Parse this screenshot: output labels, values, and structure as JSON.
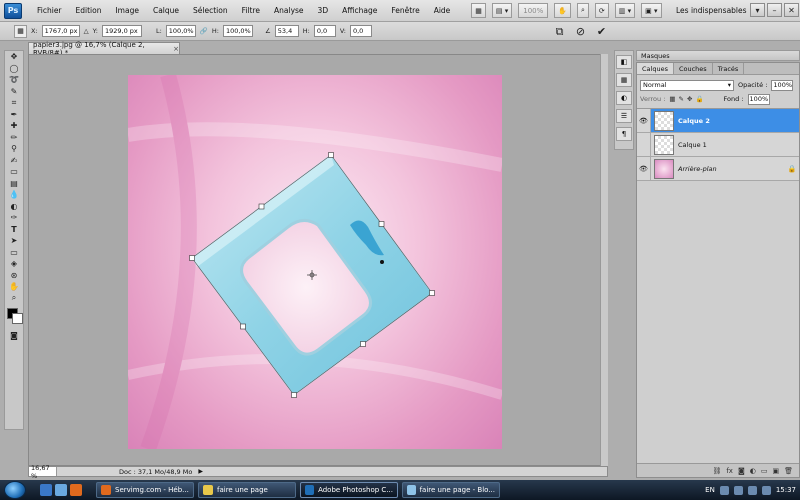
{
  "app": {
    "logo": "Ps",
    "menu": [
      "Fichier",
      "Edition",
      "Image",
      "Calque",
      "Sélection",
      "Filtre",
      "Analyse",
      "3D",
      "Affichage",
      "Fenêtre",
      "Aide"
    ],
    "zoom": "100%",
    "workspace": "Les indispensables"
  },
  "options": {
    "x_label": "X:",
    "x_value": "1767,0 px",
    "y_label": "Y:",
    "y_value": "1929,0 px",
    "w_label": "L:",
    "w_value": "100,0%",
    "h_label": "H:",
    "h_value": "100,0%",
    "angle_value": "53,4",
    "hskew_label": "H:",
    "hskew_value": "0,0",
    "vskew_label": "V:",
    "vskew_value": "0,0"
  },
  "document": {
    "tab_title": "papier3.jpg @ 16,7% (Calque 2, RVB/8#) *",
    "close_symbol": "×",
    "status_zoom": "16,67 %",
    "status_doc": "Doc : 37,1 Mo/48,9 Mo"
  },
  "panels": {
    "masques_title": "Masques",
    "tabs": [
      "Calques",
      "Couches",
      "Tracés"
    ],
    "blend_mode": "Normal",
    "opacity_label": "Opacité :",
    "opacity_value": "100%",
    "lock_label": "Verrou :",
    "fill_label": "Fond :",
    "fill_value": "100%",
    "layers": [
      {
        "name": "Calque 2",
        "selected": true,
        "visible": true
      },
      {
        "name": "Calque 1",
        "selected": false,
        "visible": false
      },
      {
        "name": "Arrière-plan",
        "selected": false,
        "visible": true,
        "locked": true
      }
    ]
  },
  "taskbar": {
    "tasks": [
      "Servimg.com - Héb...",
      "faire une page",
      "Adobe Photoshop C...",
      "faire une page - Blo..."
    ],
    "lang": "EN",
    "time": "15:37"
  },
  "colors": {
    "accent": "#3d8ee6",
    "canvas_pink": "#e59ac4",
    "frame_blue": "#8fd3e6"
  }
}
